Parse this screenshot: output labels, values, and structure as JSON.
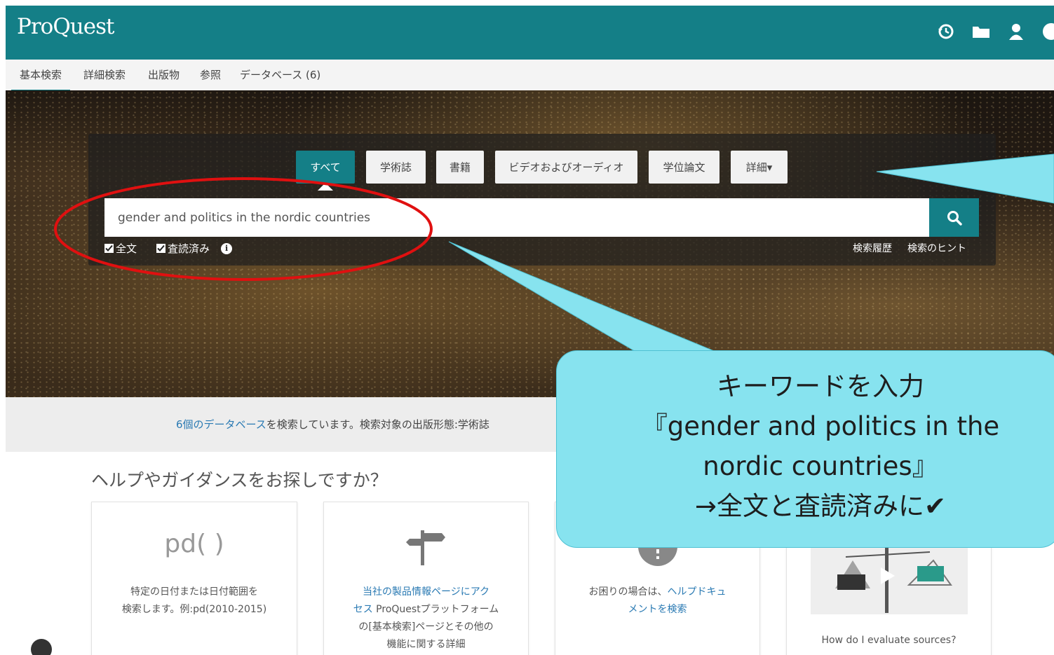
{
  "header": {
    "logo": "ProQuest",
    "icons": [
      "history-icon",
      "folder-icon",
      "user-icon",
      "help-icon"
    ]
  },
  "nav": {
    "items": [
      "基本検索",
      "詳細検索",
      "出版物",
      "参照",
      "データベース (6)"
    ],
    "active": "基本検索"
  },
  "search": {
    "filters": [
      "すべて",
      "学術誌",
      "書籍",
      "ビデオおよびオーディオ",
      "学位論文",
      "詳細▾"
    ],
    "active_filter": "すべて",
    "value": "gender and politics in the nordic countries",
    "options": [
      {
        "label": "全文",
        "checked": true
      },
      {
        "label": "査読済み",
        "checked": true
      }
    ],
    "links": [
      "検索履歴",
      "検索のヒント"
    ]
  },
  "databases": {
    "link": "6個のデータベース",
    "text": "を検索しています。検索対象の出版形態:学術誌"
  },
  "help": {
    "title": "ヘルプやガイダンスをお探しですか？",
    "cards": [
      {
        "heading": "pd( )",
        "line1": "特定の日付または日付範囲を",
        "line2": "検索します。例:pd(2010-2015)"
      },
      {
        "link1": "当社の製品情報ページにアク",
        "link2": "セス",
        "text2": " ProQuestプラットフォーム",
        "line3": "の[基本検索]ページとその他の",
        "line4": "機能に関する詳細"
      },
      {
        "text": "お困りの場合は、",
        "link1": "ヘルプドキュ",
        "link2": "メントを検索"
      },
      {
        "text": "How do I evaluate sources?"
      }
    ]
  },
  "callout": {
    "line1": "キーワードを入力",
    "line2": "『gender and politics in the",
    "line3": "nordic countries』",
    "line4": "→全文と査読済みに✔"
  },
  "colors": {
    "brand": "#147f87",
    "callout": "#87e3ef",
    "highlight_ellipse": "#e01010",
    "link": "#2a7ab3"
  }
}
